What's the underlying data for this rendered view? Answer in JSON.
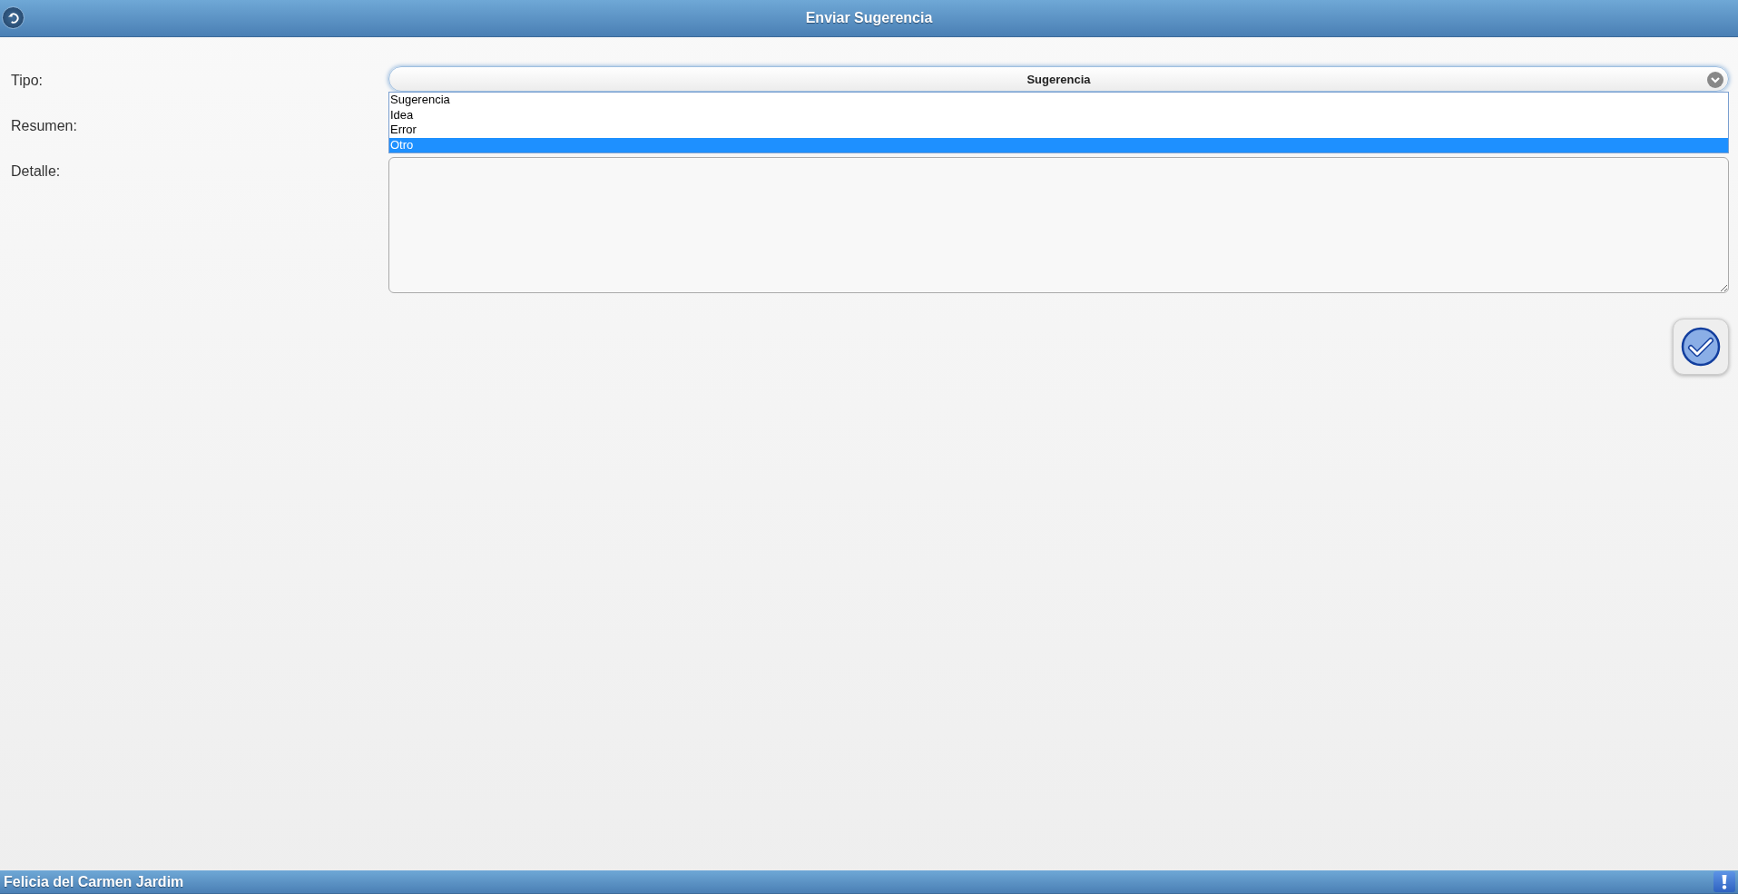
{
  "header": {
    "title": "Enviar Sugerencia"
  },
  "form": {
    "fields": [
      {
        "kind": "select",
        "label": "Tipo:",
        "value": "Sugerencia",
        "expanded": true,
        "options": [
          {
            "label": "Sugerencia",
            "highlighted": false
          },
          {
            "label": "Idea",
            "highlighted": false
          },
          {
            "label": "Error",
            "highlighted": false
          },
          {
            "label": "Otro",
            "highlighted": true
          }
        ]
      },
      {
        "kind": "text",
        "label": "Resumen:"
      },
      {
        "kind": "textarea",
        "label": "Detalle:"
      }
    ]
  },
  "footer": {
    "user": "Felicia del Carmen Jardim"
  }
}
